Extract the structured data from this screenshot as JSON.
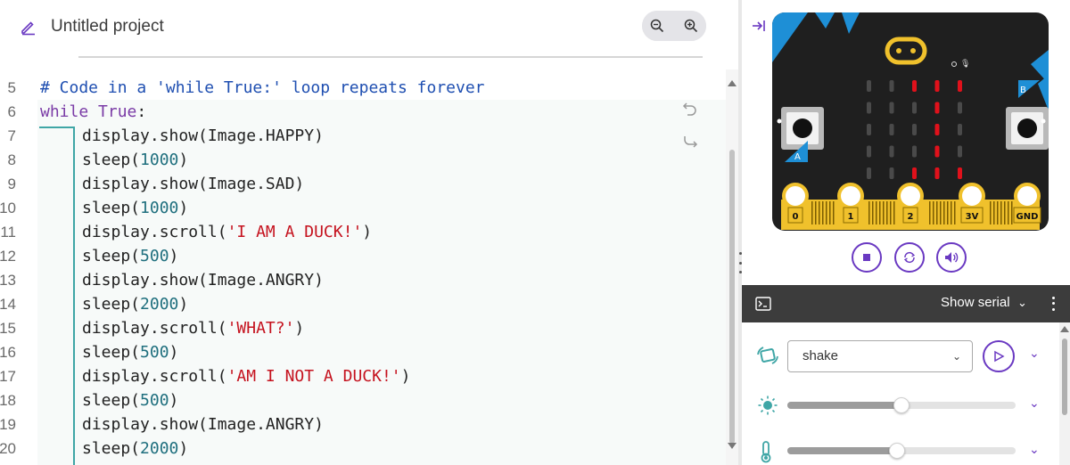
{
  "header": {
    "project_title": "Untitled project",
    "icons": [
      "pencil-icon",
      "zoom-out-icon",
      "zoom-in-icon"
    ]
  },
  "editor": {
    "lines": [
      {
        "n": "5",
        "indent": 0,
        "parts": [
          {
            "t": "# Code in a 'while True:' loop repeats forever",
            "c": "c-comment"
          }
        ]
      },
      {
        "n": "6",
        "indent": 0,
        "parts": [
          {
            "t": "while ",
            "c": "c-kw"
          },
          {
            "t": "True",
            "c": "c-kw"
          },
          {
            "t": ":",
            "c": ""
          }
        ]
      },
      {
        "n": "7",
        "indent": 1,
        "parts": [
          {
            "t": "display.show(Image.HAPPY)",
            "c": ""
          }
        ]
      },
      {
        "n": "8",
        "indent": 1,
        "parts": [
          {
            "t": "sleep(",
            "c": ""
          },
          {
            "t": "1000",
            "c": "c-num"
          },
          {
            "t": ")",
            "c": ""
          }
        ]
      },
      {
        "n": "9",
        "indent": 1,
        "parts": [
          {
            "t": "display.show(Image.SAD)",
            "c": ""
          }
        ]
      },
      {
        "n": "10",
        "indent": 1,
        "parts": [
          {
            "t": "sleep(",
            "c": ""
          },
          {
            "t": "1000",
            "c": "c-num"
          },
          {
            "t": ")",
            "c": ""
          }
        ]
      },
      {
        "n": "11",
        "indent": 1,
        "parts": [
          {
            "t": "display.scroll(",
            "c": ""
          },
          {
            "t": "'I AM A DUCK!'",
            "c": "c-str"
          },
          {
            "t": ")",
            "c": ""
          }
        ]
      },
      {
        "n": "12",
        "indent": 1,
        "parts": [
          {
            "t": "sleep(",
            "c": ""
          },
          {
            "t": "500",
            "c": "c-num"
          },
          {
            "t": ")",
            "c": ""
          }
        ]
      },
      {
        "n": "13",
        "indent": 1,
        "parts": [
          {
            "t": "display.show(Image.ANGRY)",
            "c": ""
          }
        ]
      },
      {
        "n": "14",
        "indent": 1,
        "parts": [
          {
            "t": "sleep(",
            "c": ""
          },
          {
            "t": "2000",
            "c": "c-num"
          },
          {
            "t": ")",
            "c": ""
          }
        ]
      },
      {
        "n": "15",
        "indent": 1,
        "parts": [
          {
            "t": "display.scroll(",
            "c": ""
          },
          {
            "t": "'WHAT?'",
            "c": "c-str"
          },
          {
            "t": ")",
            "c": ""
          }
        ]
      },
      {
        "n": "16",
        "indent": 1,
        "parts": [
          {
            "t": "sleep(",
            "c": ""
          },
          {
            "t": "500",
            "c": "c-num"
          },
          {
            "t": ")",
            "c": ""
          }
        ]
      },
      {
        "n": "17",
        "indent": 1,
        "parts": [
          {
            "t": "display.scroll(",
            "c": ""
          },
          {
            "t": "'AM I NOT A DUCK!'",
            "c": "c-str"
          },
          {
            "t": ")",
            "c": ""
          }
        ]
      },
      {
        "n": "18",
        "indent": 1,
        "parts": [
          {
            "t": "sleep(",
            "c": ""
          },
          {
            "t": "500",
            "c": "c-num"
          },
          {
            "t": ")",
            "c": ""
          }
        ]
      },
      {
        "n": "19",
        "indent": 1,
        "parts": [
          {
            "t": "display.show(Image.ANGRY)",
            "c": ""
          }
        ]
      },
      {
        "n": "20",
        "indent": 1,
        "parts": [
          {
            "t": "sleep(",
            "c": ""
          },
          {
            "t": "2000",
            "c": "c-num"
          },
          {
            "t": ")",
            "c": ""
          }
        ]
      }
    ],
    "icons": [
      "undo-icon",
      "redo-icon"
    ]
  },
  "simulator": {
    "button_a_label": "A",
    "button_b_label": "B",
    "pins": [
      "0",
      "1",
      "2",
      "3V",
      "GND"
    ],
    "led_grid": [
      [
        0,
        0,
        1,
        1,
        1
      ],
      [
        0,
        0,
        0,
        1,
        0
      ],
      [
        0,
        0,
        0,
        1,
        0
      ],
      [
        0,
        0,
        0,
        1,
        0
      ],
      [
        0,
        0,
        1,
        1,
        1
      ]
    ],
    "colors": {
      "board": "#1f1f1f",
      "accent": "#1e8fd6",
      "led_on": "#e0111b",
      "gold": "#f0c12c",
      "control": "#6a39c2"
    },
    "controls": [
      "stop-icon",
      "reset-icon",
      "sound-icon"
    ]
  },
  "serial": {
    "label": "Show serial",
    "icons": [
      "terminal-icon",
      "chevron-down-icon",
      "more-vertical-icon"
    ]
  },
  "sensors": {
    "gesture": {
      "value": "shake"
    },
    "light_level": 0.5,
    "temperature_level": 0.48,
    "icons": [
      "gesture-icon",
      "light-icon",
      "thermometer-icon",
      "play-icon"
    ]
  }
}
